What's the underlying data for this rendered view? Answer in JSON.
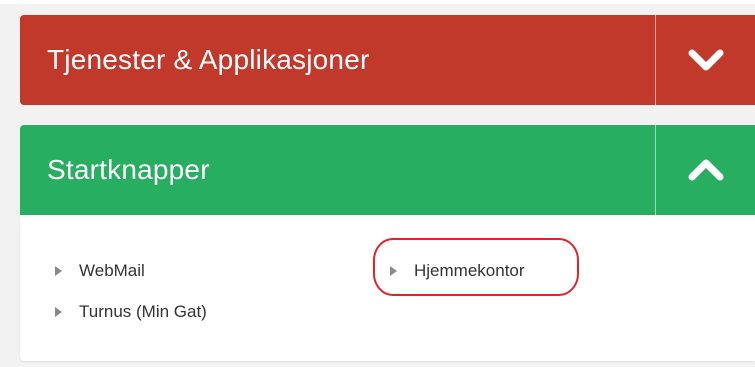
{
  "panels": {
    "services": {
      "title": "Tjenester & Applikasjoner",
      "toggle_icon": "chevron-down-icon",
      "color": "#c0392b",
      "expanded": false
    },
    "start_buttons": {
      "title": "Startknapper",
      "toggle_icon": "chevron-up-icon",
      "color": "#27ae60",
      "expanded": true
    }
  },
  "links": {
    "webmail": "WebMail",
    "turnus": "Turnus (Min Gat)",
    "hjemmekontor": "Hjemmekontor"
  },
  "annotation": {
    "highlight_color": "#e0242a"
  }
}
